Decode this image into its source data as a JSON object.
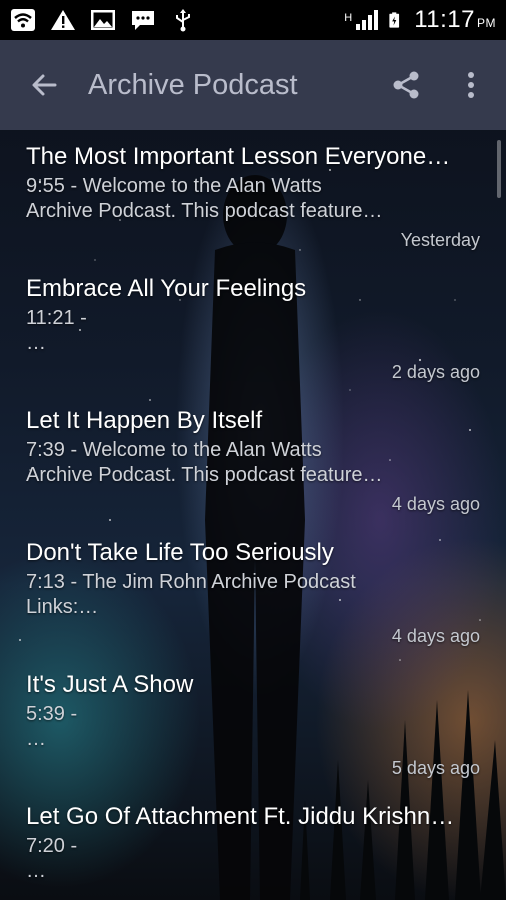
{
  "status_bar": {
    "time": "11:17",
    "ampm": "PM",
    "network_type": "H",
    "icons": [
      "wifi-icon",
      "warning-icon",
      "image-icon",
      "message-icon",
      "usb-icon",
      "signal-icon",
      "battery-icon"
    ]
  },
  "app_bar": {
    "title": "Archive Podcast",
    "back_icon": "arrow-left-icon",
    "share_icon": "share-icon",
    "menu_icon": "overflow-menu-icon",
    "background": "#353a4d"
  },
  "episodes": [
    {
      "title": "The Most Important Lesson Everyone…",
      "desc_line1": "9:55 -  Welcome to the Alan Watts",
      "desc_line2": "Archive Podcast. This podcast feature…",
      "date": "Yesterday"
    },
    {
      "title": "Embrace All Your Feelings",
      "desc_line1": "11:21 -",
      "desc_line2": "…",
      "date": "2 days ago"
    },
    {
      "title": "Let It Happen By Itself",
      "desc_line1": "7:39 -  Welcome to the Alan Watts",
      "desc_line2": "Archive Podcast. This podcast feature…",
      "date": "4 days ago"
    },
    {
      "title": "Don't Take Life Too Seriously",
      "desc_line1": "7:13 -  The Jim Rohn Archive Podcast",
      "desc_line2": "Links:…",
      "date": "4 days ago"
    },
    {
      "title": "It's Just A Show",
      "desc_line1": "5:39 -",
      "desc_line2": "…",
      "date": "5 days ago"
    },
    {
      "title": "Let Go Of Attachment Ft. Jiddu Krishn…",
      "desc_line1": "7:20 -",
      "desc_line2": "…",
      "date": ""
    }
  ]
}
